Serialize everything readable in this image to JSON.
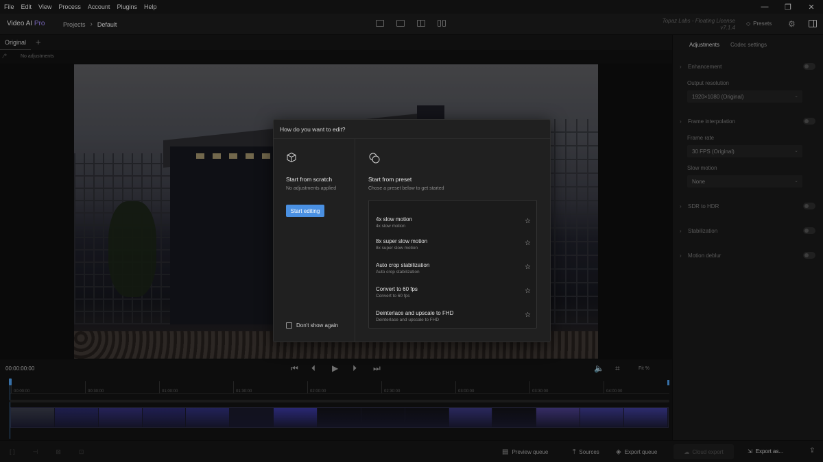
{
  "menu": [
    "File",
    "Edit",
    "View",
    "Process",
    "Account",
    "Plugins",
    "Help"
  ],
  "window_controls": {
    "minimize": "—",
    "restore": "❐",
    "close": "✕"
  },
  "app": {
    "name": "Video AI",
    "edition": "Pro"
  },
  "breadcrumb": {
    "projects": "Projects",
    "separator": "›",
    "current": "Default"
  },
  "license": {
    "line1": "Topaz Labs - Floating License",
    "line2": "v7.1.4"
  },
  "header": {
    "presets_label": "Presets"
  },
  "tabs": {
    "original": "Original",
    "add": "+"
  },
  "status": {
    "adjustments": "No adjustments"
  },
  "transport": {
    "timecode": "00:00:00:00",
    "fit_label": "Fit %"
  },
  "timeline": {
    "ticks": [
      "00:00:00",
      "00:30:00",
      "01:00:00",
      "01:30:00",
      "02:00:00",
      "02:30:00",
      "03:00:00",
      "03:30:00",
      "04:00:00"
    ]
  },
  "bottombar": {
    "preview_queue": "Preview queue",
    "sources": "Sources",
    "export_queue": "Export queue",
    "cloud_export": "Cloud export",
    "export_as": "Export as..."
  },
  "right_panel": {
    "tabs": [
      "Adjustments",
      "Codec settings"
    ],
    "sections": {
      "enhancement": "Enhancement",
      "output_resolution_label": "Output resolution",
      "output_resolution_value": "1920×1080 (Original)",
      "frame_interpolation": "Frame interpolation",
      "frame_rate_label": "Frame rate",
      "frame_rate_value": "30 FPS (Original)",
      "slow_motion_label": "Slow motion",
      "slow_motion_value": "None",
      "sdr_to_hdr": "SDR to HDR",
      "stabilization": "Stabilization",
      "motion_deblur": "Motion deblur"
    }
  },
  "dialog": {
    "title": "How do you want to edit?",
    "scratch": {
      "title": "Start from scratch",
      "subtitle": "No adjustments applied",
      "button": "Start editing"
    },
    "preset": {
      "title": "Start from preset",
      "subtitle": "Chose a preset below to get started"
    },
    "dont_show_again": "Don't show again",
    "presets": [
      {
        "name": "4x slow motion",
        "desc": "4x slow motion"
      },
      {
        "name": "8x super slow motion",
        "desc": "8x super slow motion"
      },
      {
        "name": "Auto crop stabilization",
        "desc": "Auto crop stabilization"
      },
      {
        "name": "Convert to 60 fps",
        "desc": "Convert to 60 fps"
      },
      {
        "name": "Deinterlace and upscale to FHD",
        "desc": "Deinterlace and upscale to FHD"
      }
    ]
  },
  "colors": {
    "accent": "#4a90e2",
    "pro": "#a58cff",
    "playhead": "#4d9be8"
  }
}
